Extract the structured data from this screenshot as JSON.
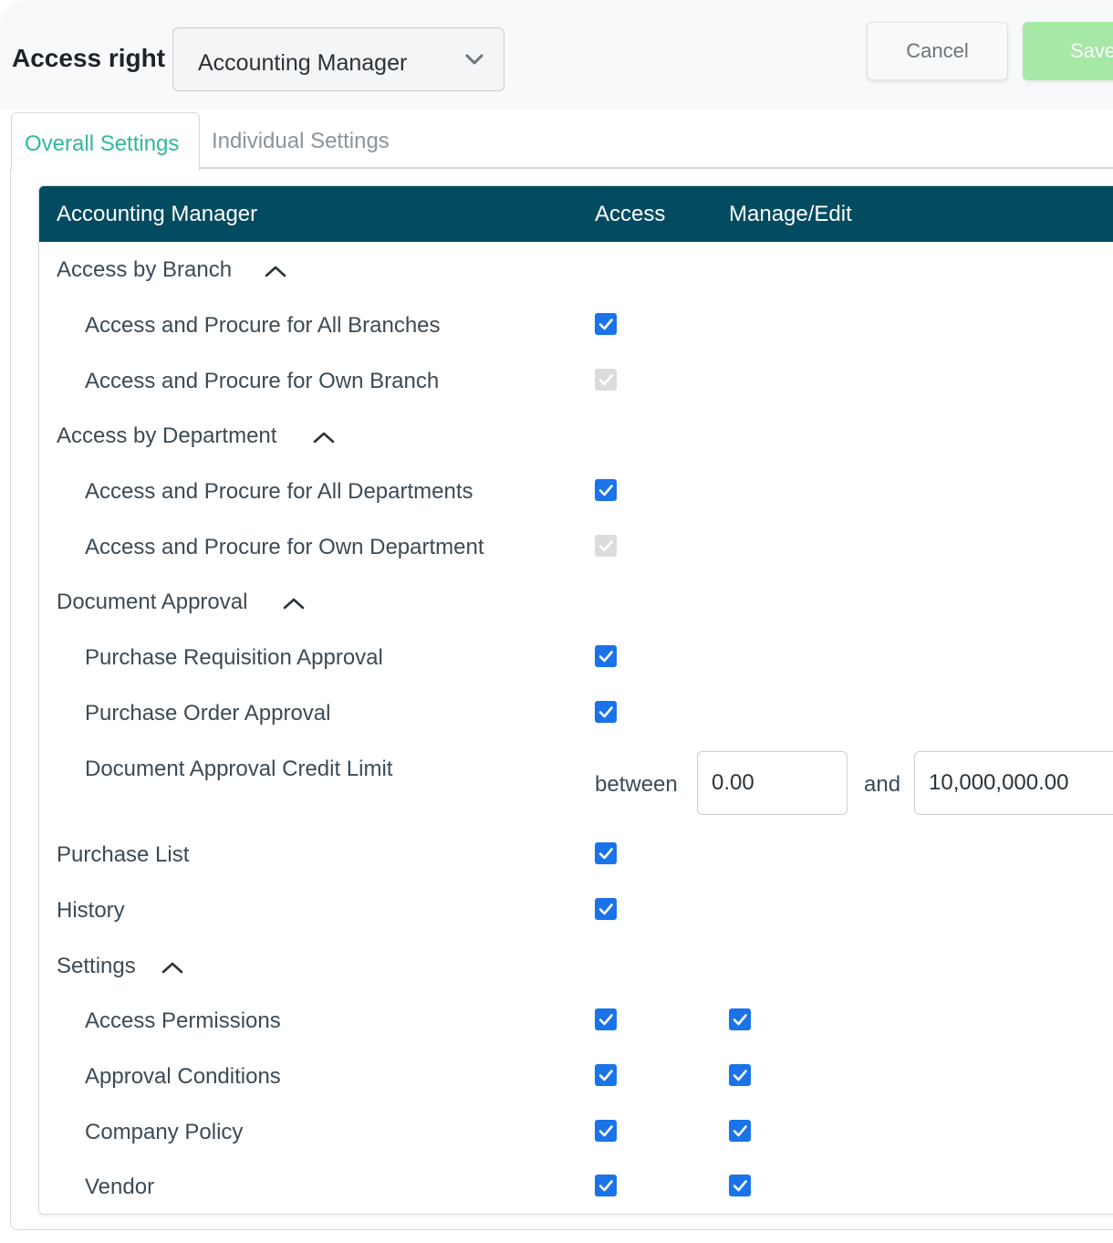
{
  "header": {
    "access_label": "Access right",
    "role_select_value": "Accounting Manager",
    "cancel_label": "Cancel",
    "save_label": "Save"
  },
  "tabs": [
    {
      "label": "Overall Settings",
      "active": true
    },
    {
      "label": "Individual Settings",
      "active": false
    }
  ],
  "table": {
    "headers": {
      "name": "Accounting Manager",
      "access": "Access",
      "manage": "Manage/Edit"
    },
    "groups": {
      "branch": {
        "label": "Access by Branch",
        "items": [
          {
            "label": "Access and Procure for All Branches",
            "access": "checked"
          },
          {
            "label": "Access and Procure for Own Branch",
            "access": "disabled"
          }
        ]
      },
      "department": {
        "label": "Access by Department",
        "items": [
          {
            "label": "Access and Procure for All Departments",
            "access": "checked"
          },
          {
            "label": "Access and Procure for Own Department",
            "access": "disabled"
          }
        ]
      },
      "approval": {
        "label": "Document Approval",
        "items": [
          {
            "label": "Purchase Requisition Approval",
            "access": "checked"
          },
          {
            "label": "Purchase Order Approval",
            "access": "checked"
          },
          {
            "label": "Document Approval Credit Limit"
          }
        ],
        "credit_limit": {
          "between_label": "between",
          "min_value": "0.00",
          "and_label": "and",
          "max_value": "10,000,000.00"
        }
      },
      "purchase_list": {
        "label": "Purchase List",
        "access": "checked"
      },
      "history": {
        "label": "History",
        "access": "checked"
      },
      "settings": {
        "label": "Settings",
        "items": [
          {
            "label": "Access Permissions",
            "access": "checked",
            "manage": "checked"
          },
          {
            "label": "Approval Conditions",
            "access": "checked",
            "manage": "checked"
          },
          {
            "label": "Company Policy",
            "access": "checked",
            "manage": "checked"
          },
          {
            "label": "Vendor",
            "access": "checked",
            "manage": "checked"
          }
        ]
      }
    }
  },
  "colors": {
    "header_bg": "#034b60",
    "checkbox": "#1a73e8",
    "checkbox_disabled": "#dcdcdc",
    "active_tab": "#2fb99c",
    "save_button": "#a6e8a6"
  }
}
